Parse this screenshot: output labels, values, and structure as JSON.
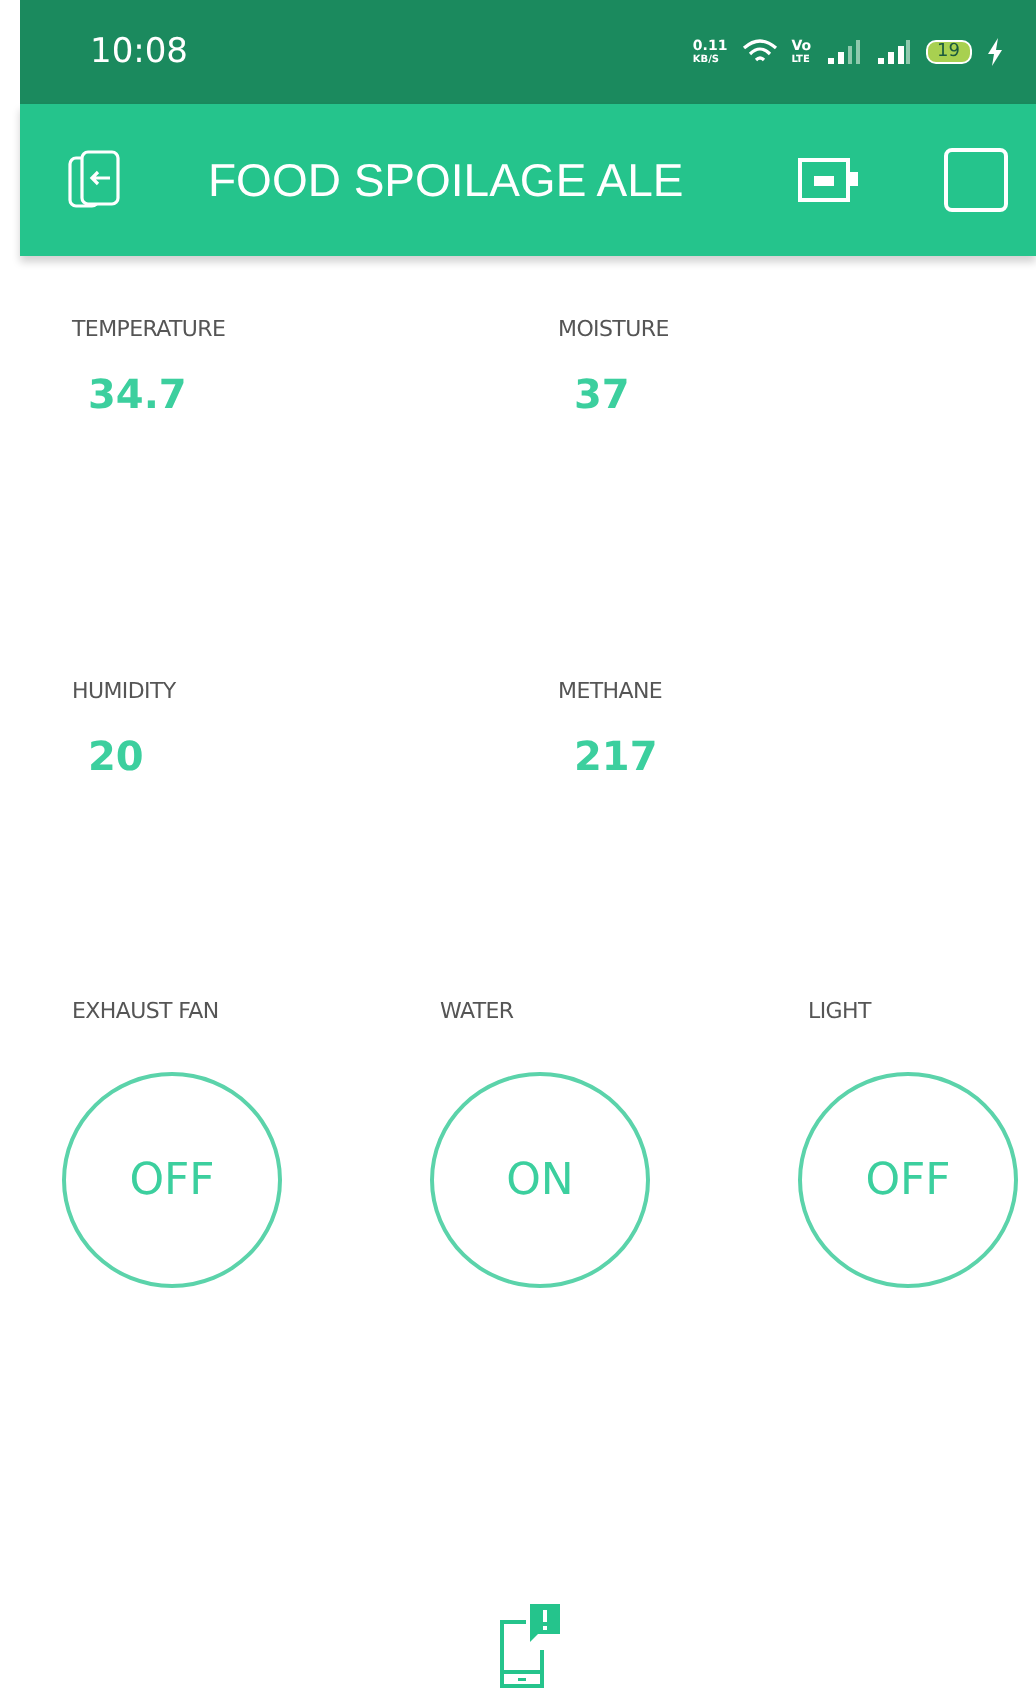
{
  "status_bar": {
    "time": "10:08",
    "speed_value": "0.11",
    "speed_unit": "KB/S",
    "network_top": "Vo",
    "network_bottom": "LTE",
    "battery": "19"
  },
  "header": {
    "title": "FOOD SPOILAGE ALE"
  },
  "readings": [
    {
      "label": "TEMPERATURE",
      "value": "34.7"
    },
    {
      "label": "MOISTURE",
      "value": "37"
    },
    {
      "label": "HUMIDITY",
      "value": "20"
    },
    {
      "label": "METHANE",
      "value": "217"
    }
  ],
  "switches": [
    {
      "label": "EXHAUST FAN",
      "state": "OFF"
    },
    {
      "label": "WATER",
      "state": "ON"
    },
    {
      "label": "LIGHT",
      "state": "OFF"
    }
  ]
}
